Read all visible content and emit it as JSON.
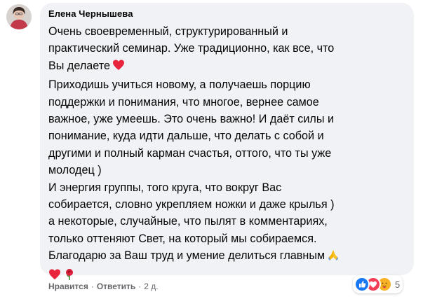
{
  "comment": {
    "author": "Елена Чернышева",
    "lines": [
      "Очень своевременный, структурированный и",
      "практический семинар. Уже традиционно, как все, что",
      "Вы делаете",
      "Приходишь учиться новому, а получаешь порцию",
      "поддержки и понимания, что многое, вернее самое",
      "важное, уже умеешь. Это очень важно! И даёт силы и",
      "понимание, куда идти дальше, что делать с собой и",
      "другими и полный карман счастья, оттого, что ты уже",
      "молодец )",
      "И энергия группы, того круга, что вокруг Вас",
      "собирается, словно укрепляем ножки и даже крылья )",
      "а некоторые, случайные, что пылят в комментариях,",
      "только оттеняют Свет, на который мы собираемся.",
      "Благодарю за Ваш труд и умение делиться главным",
      ""
    ],
    "emoji_names": [
      "red-heart-icon",
      "folded-hands-icon",
      "red-heart-icon",
      "rose-icon"
    ]
  },
  "actions": {
    "like_label": "Нравится",
    "separator": "·",
    "reply_label": "Ответить",
    "time": "2 д."
  },
  "reactions": {
    "count": "5",
    "types": [
      "like",
      "love",
      "care"
    ]
  },
  "colors": {
    "bubble": "#f0f2f5",
    "meta_text": "#65676b",
    "like_blue": "#1877f2",
    "love_red": "#f33e58",
    "care_yellow": "#f7b125"
  }
}
